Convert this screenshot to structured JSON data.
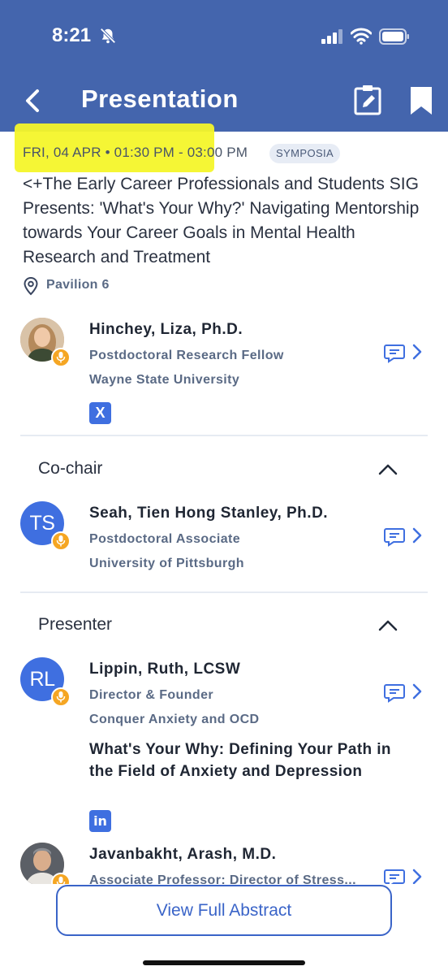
{
  "status_bar": {
    "time": "8:21"
  },
  "header": {
    "title": "Presentation"
  },
  "session": {
    "datetime": "FRI, 04 APR • 01:30 PM - 03:00 PM",
    "tag": "SYMPOSIA",
    "title": "<+The Early Career Professionals and Students SIG Presents: 'What's Your Why?' Navigating Mentorship towards Your Career Goals in Mental Health Research and Treatment",
    "location": "Pavilion 6"
  },
  "chair": {
    "name": "Hinchey, Liza, Ph.D.",
    "role": "Postdoctoral Research Fellow",
    "org": "Wayne State University",
    "social": "X"
  },
  "cochair_section": {
    "heading": "Co-chair",
    "person": {
      "initials": "TS",
      "name": "Seah, Tien Hong Stanley, Ph.D.",
      "role": "Postdoctoral Associate",
      "org": "University of Pittsburgh"
    }
  },
  "presenter_section": {
    "heading": "Presenter",
    "people": [
      {
        "initials": "RL",
        "name": "Lippin, Ruth, LCSW",
        "role": "Director & Founder",
        "org": "Conquer Anxiety and OCD",
        "talk": "What's Your Why: Defining Your Path in the Field of Anxiety and Depression",
        "social": "in"
      },
      {
        "name": "Javanbakht, Arash, M.D.",
        "role": "Associate Professor; Director of Stress..."
      }
    ]
  },
  "actions": {
    "view_abstract": "View Full Abstract"
  },
  "colors": {
    "header": "#4465ad",
    "accent": "#3f6fe0",
    "highlight": "#f4f52a",
    "mic_badge": "#f5a623"
  }
}
